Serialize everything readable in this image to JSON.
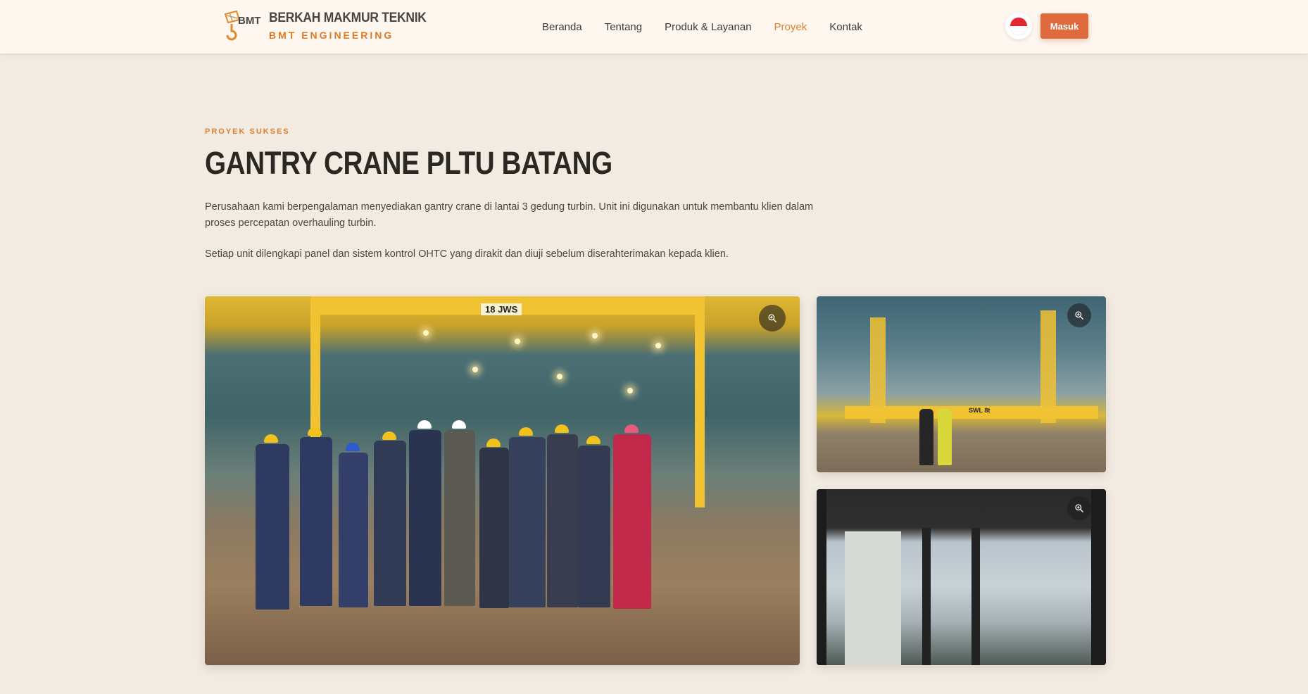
{
  "header": {
    "brand_name": "BERKAH MAKMUR TEKNIK",
    "brand_sub": "BMT ENGINEERING",
    "logo_text": "BMT",
    "nav": [
      {
        "label": "Beranda",
        "active": false
      },
      {
        "label": "Tentang",
        "active": false
      },
      {
        "label": "Produk & Layanan",
        "active": false
      },
      {
        "label": "Proyek",
        "active": true
      },
      {
        "label": "Kontak",
        "active": false
      }
    ],
    "language": "id",
    "login_label": "Masuk",
    "accent_color": "#e0812f",
    "button_color": "#df6a3e"
  },
  "project": {
    "eyebrow": "PROYEK SUKSES",
    "title": "GANTRY CRANE PLTU BATANG",
    "paragraph1": "Perusahaan kami berpengalaman menyediakan gantry crane di lantai 3 gedung turbin. Unit ini digunakan untuk membantu klien dalam proses percepatan overhauling turbin.",
    "paragraph2": "Setiap unit dilengkapi panel dan sistem kontrol OHTC yang dirakit dan diuji sebelum diserahterimakan kepada klien."
  },
  "gallery": {
    "main_label": "18 JWS",
    "side1_label": "SWL 8t",
    "zoom_icon": "zoom-in-icon"
  }
}
